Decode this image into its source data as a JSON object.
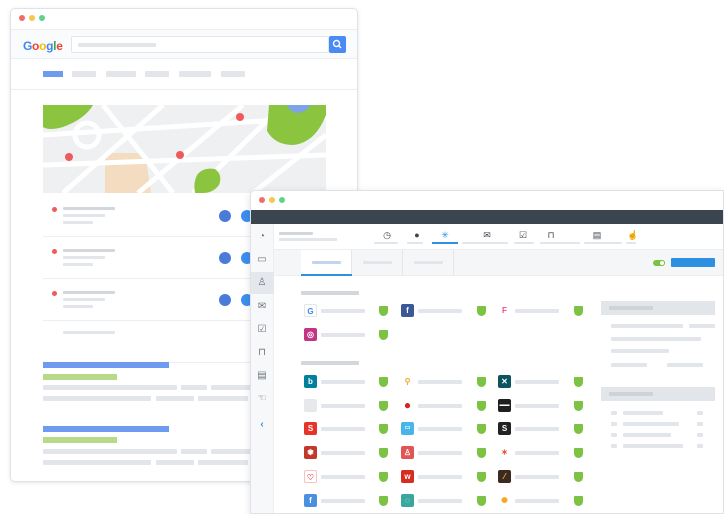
{
  "browser": {
    "search_engine_logo": "Google",
    "logo_colors": [
      "#4285f4",
      "#ea4335",
      "#fbbc05",
      "#4285f4",
      "#34a853",
      "#ea4335"
    ],
    "window_dots": [
      "#f26c6c",
      "#f5c84d",
      "#5ed48a"
    ],
    "search_button_icon": "search-icon",
    "result_icons": [
      "globe-icon",
      "navigate-icon"
    ]
  },
  "app": {
    "window_dots": [
      "#f26c6c",
      "#f5c84d",
      "#5ed48a"
    ],
    "sidebar_icons": [
      "dashboard-icon",
      "folder-icon",
      "user-icon",
      "inbox-icon",
      "checklist-icon",
      "lock-icon",
      "document-icon",
      "hand-icon",
      "chevron-left-icon"
    ],
    "toolbar_icons": [
      "clock-icon",
      "location-icon",
      "sparkle-icon",
      "mail-icon",
      "checklist-icon",
      "lock-icon",
      "document-icon",
      "thumbs-up-icon"
    ],
    "toggle_state": "on",
    "accent_color": "#2f8fe0",
    "shield_color": "#7cc243",
    "service_logos": {
      "row1": [
        "google-logo",
        "facebook-logo",
        "foursquare-logo"
      ],
      "row2": [
        "instagram-logo"
      ],
      "grid": [
        [
          "bing-logo",
          "maps-pin-logo",
          "xing-logo"
        ],
        [
          "apple-logo",
          "yelp-logo",
          "waze-logo"
        ],
        [
          "scribd-logo",
          "here-logo",
          "squarespace-logo"
        ],
        [
          "yahoo-logo",
          "healthgrades-logo",
          "superpages-logo"
        ],
        [
          "vitals-logo",
          "yellowpages-logo",
          "brownbook-logo"
        ],
        [
          "facebook-places-logo",
          "chat-logo",
          "sun-logo"
        ]
      ]
    }
  }
}
